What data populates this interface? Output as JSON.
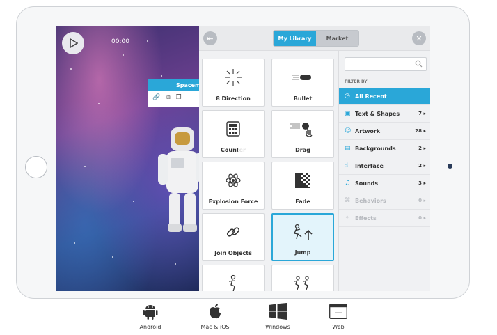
{
  "player": {
    "time": "00:00"
  },
  "object_panel": {
    "title": "Spacem"
  },
  "library": {
    "tabs": [
      {
        "label": "My Library",
        "active": true
      },
      {
        "label": "Market",
        "active": false
      }
    ],
    "tiles": [
      {
        "label": "8 Direction",
        "icon": "eight-direction-icon"
      },
      {
        "label": "Bullet",
        "icon": "bullet-icon"
      },
      {
        "label": "Counter",
        "icon": "calculator-icon"
      },
      {
        "label": "Drag",
        "icon": "drag-hand-icon"
      },
      {
        "label": "Explosion Force",
        "icon": "explosion-icon"
      },
      {
        "label": "Fade",
        "icon": "fade-icon"
      },
      {
        "label": "Join Objects",
        "icon": "link-icon"
      },
      {
        "label": "Jump",
        "icon": "jump-icon",
        "selected": true
      },
      {
        "label": "",
        "icon": "runner-icon"
      },
      {
        "label": "",
        "icon": "runners-icon"
      }
    ],
    "filter_by": "FILTER BY",
    "filters": [
      {
        "label": "All Recent",
        "count": "",
        "active": true,
        "icon": "clock-icon"
      },
      {
        "label": "Text & Shapes",
        "count": "7 ▸",
        "icon": "text-shapes-icon"
      },
      {
        "label": "Artwork",
        "count": "28 ▸",
        "icon": "artwork-icon"
      },
      {
        "label": "Backgrounds",
        "count": "2 ▸",
        "icon": "backgrounds-icon"
      },
      {
        "label": "Interface",
        "count": "2 ▸",
        "icon": "interface-icon"
      },
      {
        "label": "Sounds",
        "count": "3 ▸",
        "icon": "music-icon"
      },
      {
        "label": "Behaviors",
        "count": "0 ▸",
        "disabled": true,
        "icon": "behaviors-icon"
      },
      {
        "label": "Effects",
        "count": "0 ▸",
        "disabled": true,
        "icon": "effects-icon"
      }
    ]
  },
  "platforms": [
    {
      "label": "Android",
      "icon": "android-icon"
    },
    {
      "label": "Mac & iOS",
      "icon": "apple-icon"
    },
    {
      "label": "Windows",
      "icon": "windows-icon"
    },
    {
      "label": "Web",
      "icon": "web-browser-icon"
    }
  ],
  "colors": {
    "accent": "#2aa7d8",
    "panel_bg": "#f0f1f3"
  }
}
